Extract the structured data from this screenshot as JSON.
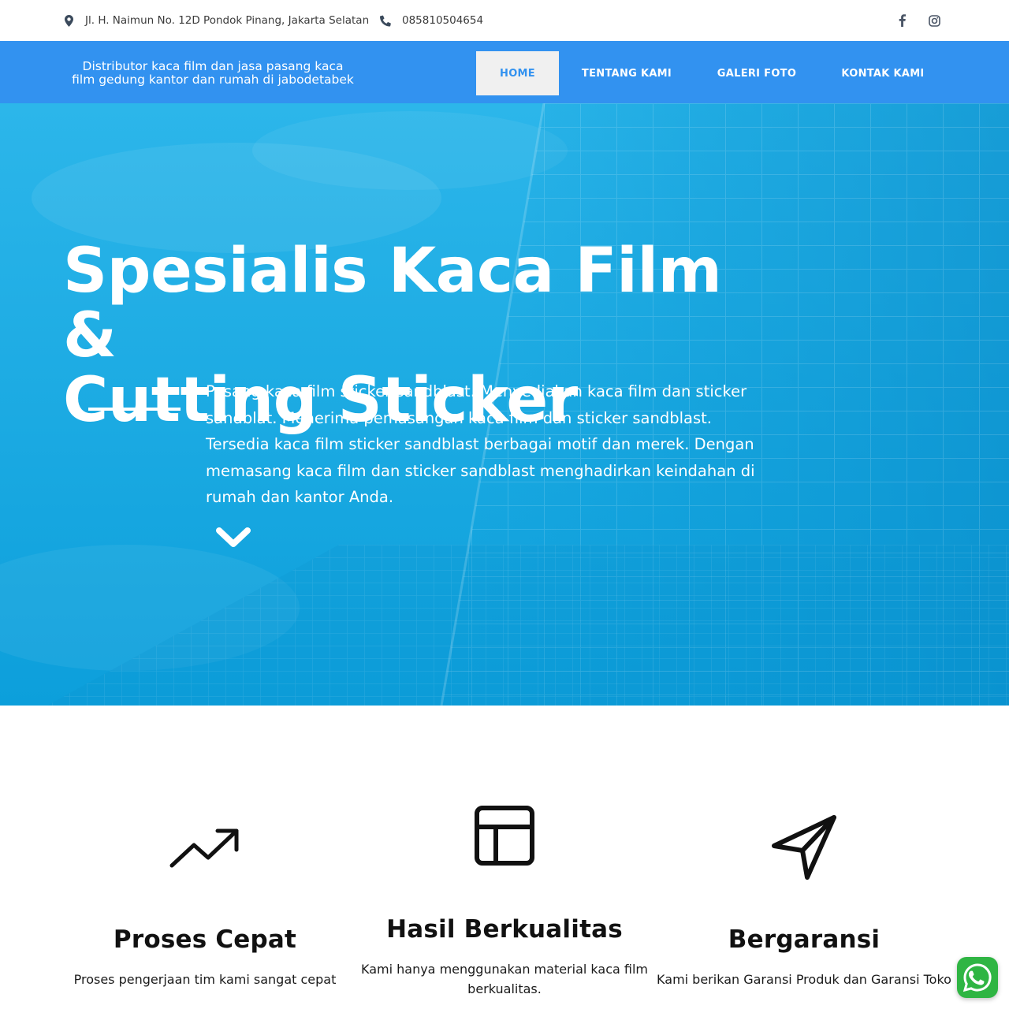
{
  "topbar": {
    "address": "Jl. H. Naimun No. 12D Pondok Pinang, Jakarta Selatan",
    "phone": "085810504654",
    "address_icon": "map-marker-icon",
    "phone_icon": "phone-icon",
    "social": [
      "facebook-icon",
      "instagram-icon"
    ]
  },
  "navbar": {
    "tagline_line1": "Distributor kaca film dan jasa pasang kaca",
    "tagline_line2": "film gedung kantor dan rumah di jabodetabek",
    "items": [
      {
        "label": "HOME",
        "active": true
      },
      {
        "label": "TENTANG KAMI",
        "active": false
      },
      {
        "label": "GALERI FOTO",
        "active": false
      },
      {
        "label": "KONTAK KAMI",
        "active": false
      }
    ]
  },
  "hero": {
    "title_line1": "Spesialis Kaca Film &",
    "title_line2": "Cutting Sticker",
    "description": "Pasang kaca film sticker sandblast. Menyediakan kaca film dan sticker sandblat. Menerima pemasangan kaca film dan sticker sandblast. Tersedia kaca film sticker sandblast berbagai motif dan merek. Dengan memasang kaca film dan sticker sandblast menghadirkan keindahan di rumah dan kantor Anda.",
    "scroll_icon": "chevron-down-icon"
  },
  "features": [
    {
      "icon": "trending-up-icon",
      "title": "Proses Cepat",
      "text": "Proses pengerjaan tim kami sangat cepat"
    },
    {
      "icon": "layout-icon",
      "title": "Hasil Berkualitas",
      "text": "Kami hanya menggunakan material kaca film berkualitas."
    },
    {
      "icon": "send-icon",
      "title": "Bergaransi",
      "text": "Kami berikan Garansi Produk dan Garansi Toko"
    }
  ],
  "colors": {
    "nav_blue": "#3292f0",
    "hero_blue": "#10a6e2",
    "whatsapp_green": "#2fb543"
  },
  "whatsapp_icon": "whatsapp-icon"
}
